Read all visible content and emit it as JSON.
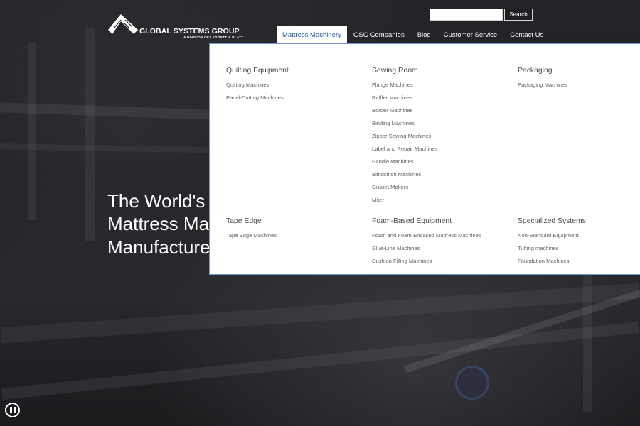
{
  "logo": {
    "title": "GLOBAL SYSTEMS GROUP",
    "subtitle": "A DIVISION OF LEGGETT & PLATT"
  },
  "search": {
    "placeholder": "",
    "value": "",
    "button_label": "Search"
  },
  "nav": {
    "items": [
      {
        "label": "Mattress Machinery",
        "active": true
      },
      {
        "label": "GSG Companies"
      },
      {
        "label": "Blog"
      },
      {
        "label": "Customer Service"
      },
      {
        "label": "Contact Us"
      }
    ]
  },
  "mega_menu": {
    "columns": [
      {
        "heading": "Quilting Equipment",
        "links": [
          "Quilting Machines",
          "Panel-Cutting Machines"
        ]
      },
      {
        "heading": "Sewing Room",
        "links": [
          "Flange Machines",
          "Ruffler Machines",
          "Border Machines",
          "Binding Machines",
          "Zipper Sewing Machines",
          "Label and Repair Machines",
          "Handle Machines",
          "Blindstitch Machines",
          "Gusset Makers",
          "Miter"
        ]
      },
      {
        "heading": "Packaging",
        "links": [
          "Packaging Machines"
        ]
      },
      {
        "heading": "Tape Edge",
        "links": [
          "Tape Edge Machines"
        ]
      },
      {
        "heading": "Foam-Based Equipment",
        "links": [
          "Foam and Foam-Encased Mattress Machines",
          "Glue-Line Machines",
          "Cushion Filling Machines"
        ]
      },
      {
        "heading": "Specialized Systems",
        "links": [
          "Non-Standard Equipment",
          "Tufting machines",
          "Foundation Machines"
        ]
      }
    ]
  },
  "hero": {
    "lines": [
      "The World's L",
      "Mattress Mac",
      "Manufacture"
    ]
  },
  "video": {
    "pause_icon": "pause-icon"
  },
  "colors": {
    "nav_active_text": "#1b5aa3",
    "menu_border": "#6f9ad0",
    "background": "#1b1c1f"
  }
}
